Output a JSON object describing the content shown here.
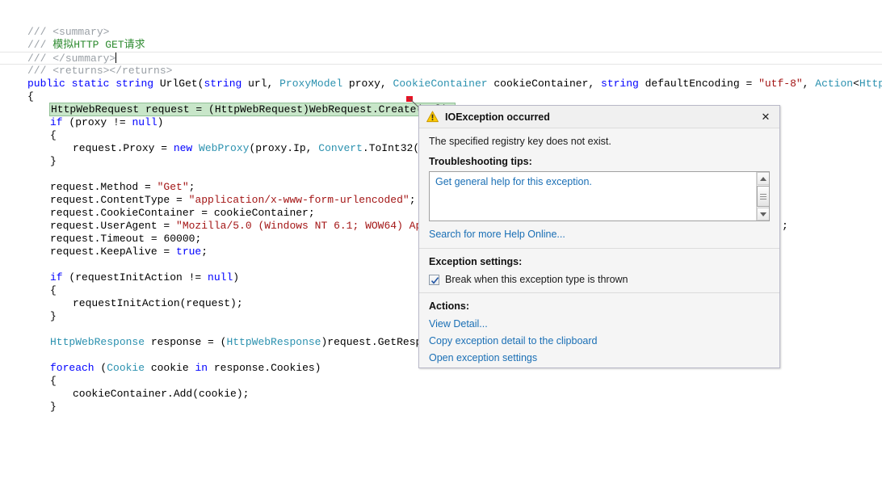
{
  "editor": {
    "lines": [
      {
        "indent": 0,
        "tokens": [
          {
            "t": "/// ",
            "c": "cmtx"
          },
          {
            "t": "<summary>",
            "c": "cmtx"
          }
        ]
      },
      {
        "indent": 0,
        "tokens": [
          {
            "t": "/// ",
            "c": "cmtx"
          },
          {
            "t": "模拟HTTP GET请求",
            "c": "cmt"
          }
        ]
      },
      {
        "indent": 0,
        "current": true,
        "caret": true,
        "tokens": [
          {
            "t": "/// ",
            "c": "cmtx"
          },
          {
            "t": "</summary>",
            "c": "cmtx"
          }
        ]
      },
      {
        "indent": 0,
        "tokens": [
          {
            "t": "/// ",
            "c": "cmtx"
          },
          {
            "t": "<returns></returns>",
            "c": "cmtx"
          }
        ]
      },
      {
        "indent": 0,
        "tokens": [
          {
            "t": "public",
            "c": "kw"
          },
          {
            "t": " ",
            "c": "pln"
          },
          {
            "t": "static",
            "c": "kw"
          },
          {
            "t": " ",
            "c": "pln"
          },
          {
            "t": "string",
            "c": "kw"
          },
          {
            "t": " UrlGet(",
            "c": "pln"
          },
          {
            "t": "string",
            "c": "kw"
          },
          {
            "t": " url, ",
            "c": "pln"
          },
          {
            "t": "ProxyModel",
            "c": "typ"
          },
          {
            "t": " proxy, ",
            "c": "pln"
          },
          {
            "t": "CookieContainer",
            "c": "typ"
          },
          {
            "t": " cookieContainer, ",
            "c": "pln"
          },
          {
            "t": "string",
            "c": "kw"
          },
          {
            "t": " defaultEncoding = ",
            "c": "pln"
          },
          {
            "t": "\"utf-8\"",
            "c": "str"
          },
          {
            "t": ", ",
            "c": "pln"
          },
          {
            "t": "Action",
            "c": "typ"
          },
          {
            "t": "<",
            "c": "pln"
          },
          {
            "t": "HttpWebRequest",
            "c": "typ"
          }
        ]
      },
      {
        "indent": 0,
        "tokens": [
          {
            "t": "{",
            "c": "pln"
          }
        ]
      },
      {
        "indent": 1,
        "highlight": true,
        "marker": true,
        "tokens": [
          {
            "t": "HttpWebRequest request = (HttpWebRequest)WebRequest.Create(url);",
            "c": "pln"
          }
        ]
      },
      {
        "indent": 1,
        "tokens": [
          {
            "t": "if",
            "c": "kw"
          },
          {
            "t": " (proxy != ",
            "c": "pln"
          },
          {
            "t": "null",
            "c": "kw"
          },
          {
            "t": ")",
            "c": "pln"
          }
        ]
      },
      {
        "indent": 1,
        "tokens": [
          {
            "t": "{",
            "c": "pln"
          }
        ]
      },
      {
        "indent": 2,
        "tokens": [
          {
            "t": "request.Proxy = ",
            "c": "pln"
          },
          {
            "t": "new",
            "c": "kw"
          },
          {
            "t": " ",
            "c": "pln"
          },
          {
            "t": "WebProxy",
            "c": "typ"
          },
          {
            "t": "(proxy.Ip, ",
            "c": "pln"
          },
          {
            "t": "Convert",
            "c": "typ"
          },
          {
            "t": ".ToInt32(proxy.P",
            "c": "pln"
          }
        ]
      },
      {
        "indent": 1,
        "tokens": [
          {
            "t": "}",
            "c": "pln"
          }
        ]
      },
      {
        "indent": 0,
        "tokens": []
      },
      {
        "indent": 1,
        "tokens": [
          {
            "t": "request.Method = ",
            "c": "pln"
          },
          {
            "t": "\"Get\"",
            "c": "str"
          },
          {
            "t": ";",
            "c": "pln"
          }
        ]
      },
      {
        "indent": 1,
        "tokens": [
          {
            "t": "request.ContentType = ",
            "c": "pln"
          },
          {
            "t": "\"application/x-www-form-urlencoded\"",
            "c": "str"
          },
          {
            "t": ";",
            "c": "pln"
          }
        ]
      },
      {
        "indent": 1,
        "tokens": [
          {
            "t": "request.CookieContainer = cookieContainer;",
            "c": "pln"
          }
        ]
      },
      {
        "indent": 1,
        "tailSemicolon": true,
        "tokens": [
          {
            "t": "request.UserAgent = ",
            "c": "pln"
          },
          {
            "t": "\"Mozilla/5.0 (Windows NT 6.1; WOW64) AppleWebK",
            "c": "str"
          }
        ]
      },
      {
        "indent": 1,
        "tokens": [
          {
            "t": "request.Timeout = ",
            "c": "pln"
          },
          {
            "t": "60000",
            "c": "num"
          },
          {
            "t": ";",
            "c": "pln"
          }
        ]
      },
      {
        "indent": 1,
        "tokens": [
          {
            "t": "request.KeepAlive = ",
            "c": "pln"
          },
          {
            "t": "true",
            "c": "kw"
          },
          {
            "t": ";",
            "c": "pln"
          }
        ]
      },
      {
        "indent": 0,
        "tokens": []
      },
      {
        "indent": 1,
        "tokens": [
          {
            "t": "if",
            "c": "kw"
          },
          {
            "t": " (requestInitAction != ",
            "c": "pln"
          },
          {
            "t": "null",
            "c": "kw"
          },
          {
            "t": ")",
            "c": "pln"
          }
        ]
      },
      {
        "indent": 1,
        "tokens": [
          {
            "t": "{",
            "c": "pln"
          }
        ]
      },
      {
        "indent": 2,
        "tokens": [
          {
            "t": "requestInitAction(request);",
            "c": "pln"
          }
        ]
      },
      {
        "indent": 1,
        "tokens": [
          {
            "t": "}",
            "c": "pln"
          }
        ]
      },
      {
        "indent": 0,
        "tokens": []
      },
      {
        "indent": 1,
        "tokens": [
          {
            "t": "HttpWebResponse",
            "c": "typ"
          },
          {
            "t": " response = (",
            "c": "pln"
          },
          {
            "t": "HttpWebResponse",
            "c": "typ"
          },
          {
            "t": ")request.GetResponse();",
            "c": "pln"
          }
        ]
      },
      {
        "indent": 0,
        "tokens": []
      },
      {
        "indent": 1,
        "tokens": [
          {
            "t": "foreach",
            "c": "kw"
          },
          {
            "t": " (",
            "c": "pln"
          },
          {
            "t": "Cookie",
            "c": "typ"
          },
          {
            "t": " cookie ",
            "c": "pln"
          },
          {
            "t": "in",
            "c": "kw"
          },
          {
            "t": " response.Cookies)",
            "c": "pln"
          }
        ]
      },
      {
        "indent": 1,
        "tokens": [
          {
            "t": "{",
            "c": "pln"
          }
        ]
      },
      {
        "indent": 2,
        "tokens": [
          {
            "t": "cookieContainer.Add(cookie);",
            "c": "pln"
          }
        ]
      },
      {
        "indent": 1,
        "tokens": [
          {
            "t": "}",
            "c": "pln"
          }
        ]
      }
    ]
  },
  "dialog": {
    "icon": "warning-triangle-icon",
    "title": "IOException occurred",
    "close_label": "✕",
    "message": "The specified registry key does not exist.",
    "tips_heading": "Troubleshooting tips:",
    "tips_link": "Get general help for this exception.",
    "search_online": "Search for more Help Online...",
    "settings_heading": "Exception settings:",
    "break_checkbox_label": "Break when this exception type is thrown",
    "break_checkbox_checked": true,
    "actions_heading": "Actions:",
    "actions": [
      "View Detail...",
      "Copy exception detail to the clipboard",
      "Open exception settings"
    ]
  },
  "colors": {
    "link": "#1a6fb5",
    "statement_highlight": "#c8e6c9",
    "error_marker": "#e81123",
    "warning_icon": "#ffcc00",
    "comment_green": "#2e8b30",
    "keyword_blue": "#0000ff",
    "type_teal": "#2b91af",
    "string_red": "#a31515"
  }
}
